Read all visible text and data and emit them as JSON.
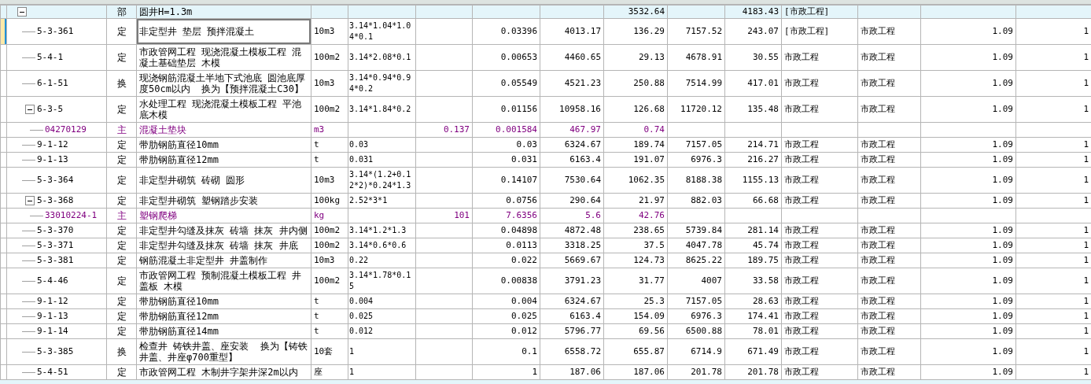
{
  "rows": [
    {
      "kind": "section",
      "selected": false,
      "expanded": true,
      "cells": [
        null,
        "部",
        "圆井H=1.3m",
        null,
        null,
        null,
        null,
        null,
        "3532.64",
        null,
        "4183.43",
        "[市政工程]",
        null,
        null,
        null
      ],
      "children": [
        {
          "kind": "item",
          "selected": true,
          "cells": [
            "5-3-361",
            "定",
            "非定型井 垫层 预拌混凝土",
            "10m3",
            "3.14*1.04*1.04*0.1",
            null,
            "0.03396",
            "4013.17",
            "136.29",
            "7157.52",
            "243.07",
            "[市政工程]",
            "市政工程",
            "1.09",
            "1"
          ]
        },
        {
          "kind": "item",
          "selected": false,
          "cells": [
            "5-4-1",
            "定",
            "市政管网工程 现浇混凝土模板工程 混凝土基础垫层 木模",
            "100m2",
            "3.14*2.08*0.1",
            null,
            "0.00653",
            "4460.65",
            "29.13",
            "4678.91",
            "30.55",
            "市政工程",
            "市政工程",
            "1.09",
            "1"
          ]
        },
        {
          "kind": "item",
          "selected": false,
          "cells": [
            "6-1-51",
            "换",
            "现浇钢筋混凝土半地下式池底 圆池底厚度50cm以内  换为【预拌混凝土C30】",
            "10m3",
            "3.14*0.94*0.94*0.2",
            null,
            "0.05549",
            "4521.23",
            "250.88",
            "7514.99",
            "417.01",
            "市政工程",
            "市政工程",
            "1.09",
            "1"
          ]
        },
        {
          "kind": "item",
          "selected": false,
          "expanded": true,
          "cells": [
            "6-3-5",
            "定",
            "水处理工程 现浇混凝土模板工程 平池底木模",
            "100m2",
            "3.14*1.84*0.2",
            null,
            "0.01156",
            "10958.16",
            "126.68",
            "11720.12",
            "135.48",
            "市政工程",
            "市政工程",
            "1.09",
            "1"
          ],
          "children": [
            {
              "kind": "material",
              "selected": false,
              "cells": [
                "04270129",
                "主",
                "混凝土垫块",
                "m3",
                null,
                "0.137",
                "0.001584",
                "467.97",
                "0.74",
                null,
                null,
                null,
                null,
                null,
                null
              ]
            }
          ]
        },
        {
          "kind": "item",
          "selected": false,
          "cells": [
            "9-1-12",
            "定",
            "带肋钢筋直径10mm",
            "t",
            "0.03",
            null,
            "0.03",
            "6324.67",
            "189.74",
            "7157.05",
            "214.71",
            "市政工程",
            "市政工程",
            "1.09",
            "1"
          ]
        },
        {
          "kind": "item",
          "selected": false,
          "cells": [
            "9-1-13",
            "定",
            "带肋钢筋直径12mm",
            "t",
            "0.031",
            null,
            "0.031",
            "6163.4",
            "191.07",
            "6976.3",
            "216.27",
            "市政工程",
            "市政工程",
            "1.09",
            "1"
          ]
        },
        {
          "kind": "item",
          "selected": false,
          "cells": [
            "5-3-364",
            "定",
            "非定型井砌筑 砖砌 圆形",
            "10m3",
            "3.14*(1.2+0.12*2)*0.24*1.3",
            null,
            "0.14107",
            "7530.64",
            "1062.35",
            "8188.38",
            "1155.13",
            "市政工程",
            "市政工程",
            "1.09",
            "1"
          ]
        },
        {
          "kind": "item",
          "selected": false,
          "expanded": true,
          "cells": [
            "5-3-368",
            "定",
            "非定型井砌筑 塑钢踏步安装",
            "100kg",
            "2.52*3*1",
            null,
            "0.0756",
            "290.64",
            "21.97",
            "882.03",
            "66.68",
            "市政工程",
            "市政工程",
            "1.09",
            "1"
          ],
          "children": [
            {
              "kind": "material",
              "selected": false,
              "cells": [
                "33010224-1",
                "主",
                "塑钢爬梯",
                "kg",
                null,
                "101",
                "7.6356",
                "5.6",
                "42.76",
                null,
                null,
                null,
                null,
                null,
                null
              ]
            }
          ]
        },
        {
          "kind": "item",
          "selected": false,
          "cells": [
            "5-3-370",
            "定",
            "非定型井勾缝及抹灰 砖墙 抹灰 井内侧",
            "100m2",
            "3.14*1.2*1.3",
            null,
            "0.04898",
            "4872.48",
            "238.65",
            "5739.84",
            "281.14",
            "市政工程",
            "市政工程",
            "1.09",
            "1"
          ]
        },
        {
          "kind": "item",
          "selected": false,
          "cells": [
            "5-3-371",
            "定",
            "非定型井勾缝及抹灰 砖墙 抹灰 井底",
            "100m2",
            "3.14*0.6*0.6",
            null,
            "0.0113",
            "3318.25",
            "37.5",
            "4047.78",
            "45.74",
            "市政工程",
            "市政工程",
            "1.09",
            "1"
          ]
        },
        {
          "kind": "item",
          "selected": false,
          "cells": [
            "5-3-381",
            "定",
            "钢筋混凝土非定型井 井盖制作",
            "10m3",
            "0.22",
            null,
            "0.022",
            "5669.67",
            "124.73",
            "8625.22",
            "189.75",
            "市政工程",
            "市政工程",
            "1.09",
            "1"
          ]
        },
        {
          "kind": "item",
          "selected": false,
          "cells": [
            "5-4-46",
            "定",
            "市政管网工程 预制混凝土模板工程 井盖板 木模",
            "100m2",
            "3.14*1.78*0.15",
            null,
            "0.00838",
            "3791.23",
            "31.77",
            "4007",
            "33.58",
            "市政工程",
            "市政工程",
            "1.09",
            "1"
          ]
        },
        {
          "kind": "item",
          "selected": false,
          "cells": [
            "9-1-12",
            "定",
            "带肋钢筋直径10mm",
            "t",
            "0.004",
            null,
            "0.004",
            "6324.67",
            "25.3",
            "7157.05",
            "28.63",
            "市政工程",
            "市政工程",
            "1.09",
            "1"
          ]
        },
        {
          "kind": "item",
          "selected": false,
          "cells": [
            "9-1-13",
            "定",
            "带肋钢筋直径12mm",
            "t",
            "0.025",
            null,
            "0.025",
            "6163.4",
            "154.09",
            "6976.3",
            "174.41",
            "市政工程",
            "市政工程",
            "1.09",
            "1"
          ]
        },
        {
          "kind": "item",
          "selected": false,
          "cells": [
            "9-1-14",
            "定",
            "带肋钢筋直径14mm",
            "t",
            "0.012",
            null,
            "0.012",
            "5796.77",
            "69.56",
            "6500.88",
            "78.01",
            "市政工程",
            "市政工程",
            "1.09",
            "1"
          ]
        },
        {
          "kind": "item",
          "selected": false,
          "cells": [
            "5-3-385",
            "换",
            "检查井 铸铁井盖、座安装  换为【铸铁井盖、井座φ700重型】",
            "10套",
            "1",
            null,
            "0.1",
            "6558.72",
            "655.87",
            "6714.9",
            "671.49",
            "市政工程",
            "市政工程",
            "1.09",
            "1"
          ]
        },
        {
          "kind": "item",
          "selected": false,
          "cells": [
            "5-4-51",
            "定",
            "市政管网工程 木制井字架井深2m以内",
            "座",
            "1",
            null,
            "1",
            "187.06",
            "187.06",
            "201.78",
            "201.78",
            "市政工程",
            "市政工程",
            "1.09",
            "1"
          ]
        }
      ]
    }
  ]
}
